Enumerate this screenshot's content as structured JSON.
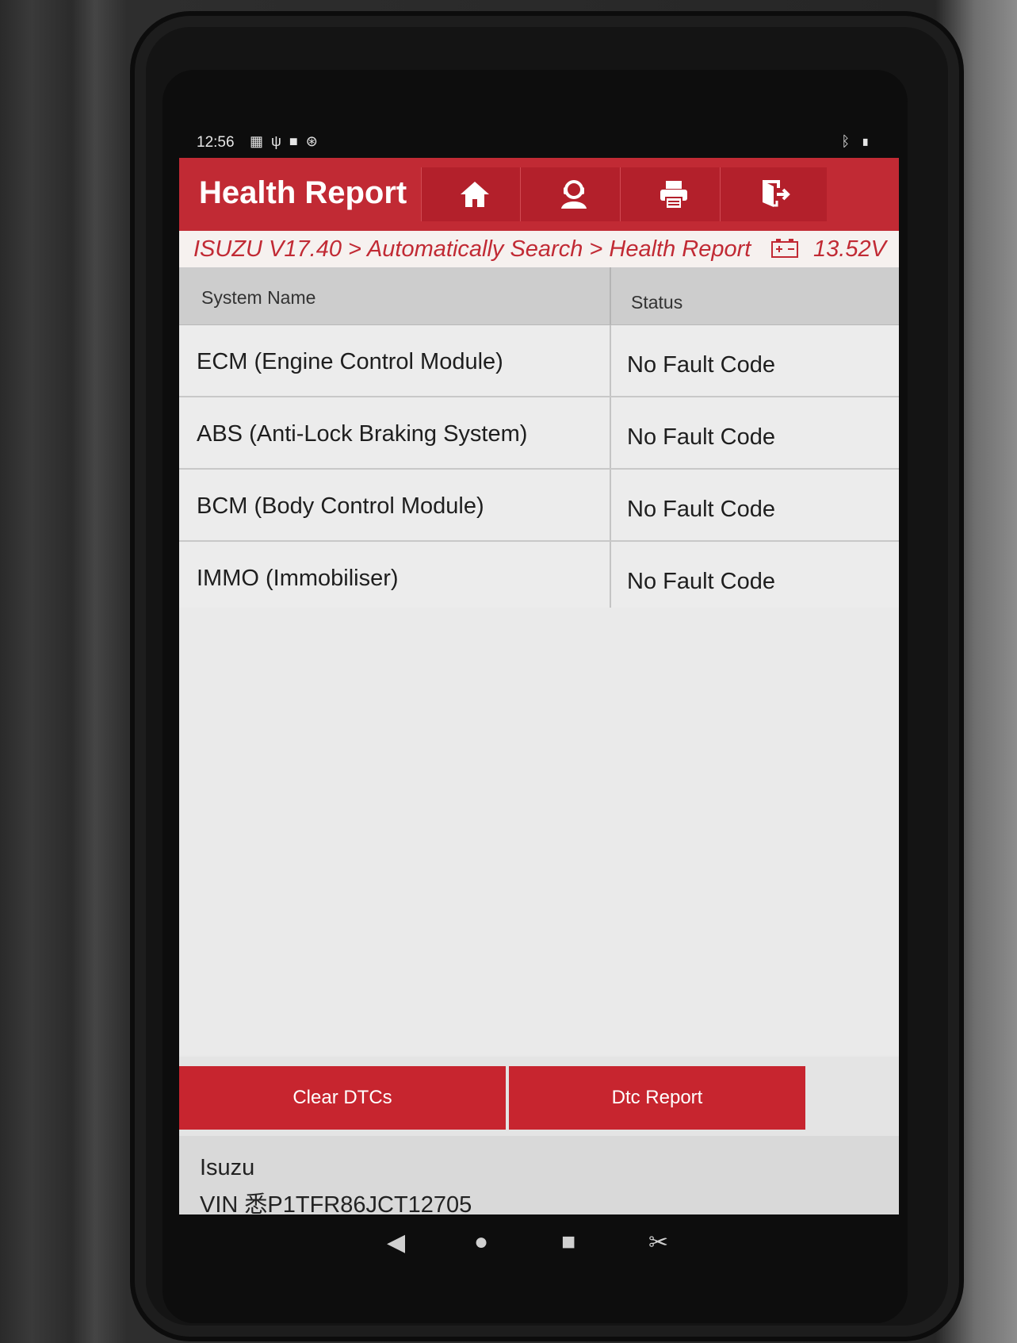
{
  "status_bar": {
    "time": "12:56",
    "notif_icons": [
      "sim-icon",
      "usb-icon",
      "image-icon",
      "settings-icon"
    ],
    "right_icons": [
      "bluetooth-icon",
      "battery-icon"
    ]
  },
  "header": {
    "title": "Health Report",
    "buttons": [
      "home-icon",
      "support-icon",
      "print-icon",
      "exit-icon"
    ]
  },
  "breadcrumb": {
    "path": "ISUZU V17.40 > Automatically Search > Health Report",
    "voltage": "13.52V"
  },
  "table": {
    "columns": [
      "System Name",
      "Status"
    ],
    "rows": [
      {
        "system": "ECM (Engine Control Module)",
        "status": "No Fault Code"
      },
      {
        "system": "ABS (Anti-Lock Braking System)",
        "status": "No Fault Code"
      },
      {
        "system": "BCM (Body Control Module)",
        "status": "No Fault Code"
      },
      {
        "system": "IMMO (Immobiliser)",
        "status": "No Fault Code"
      }
    ]
  },
  "actions": {
    "clear": "Clear DTCs",
    "report": "Dtc Report"
  },
  "footer": {
    "make": "Isuzu",
    "vin": "VIN 悉P1TFR86JCT12705"
  },
  "colors": {
    "accent": "#c12a34",
    "header_button": "#b3202b"
  }
}
